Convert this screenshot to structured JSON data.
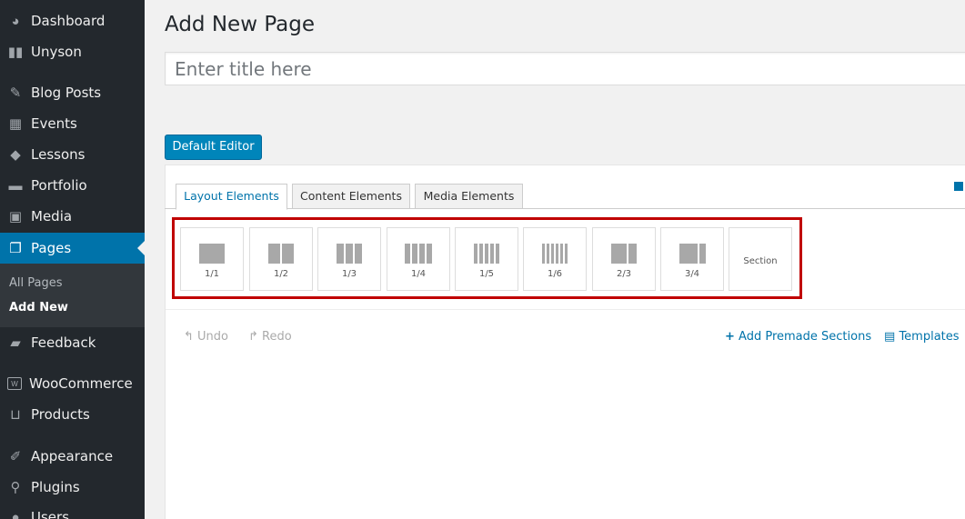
{
  "sidebar": {
    "items": [
      {
        "label": "Dashboard",
        "icon": "dashboard-icon"
      },
      {
        "label": "Unyson",
        "icon": "unyson-icon"
      },
      {
        "label": "Blog Posts",
        "icon": "pin-icon"
      },
      {
        "label": "Events",
        "icon": "calendar-icon"
      },
      {
        "label": "Lessons",
        "icon": "graduation-cap-icon"
      },
      {
        "label": "Portfolio",
        "icon": "folder-icon"
      },
      {
        "label": "Media",
        "icon": "media-icon"
      },
      {
        "label": "Pages",
        "icon": "pages-icon"
      },
      {
        "label": "Feedback",
        "icon": "comment-icon"
      },
      {
        "label": "WooCommerce",
        "icon": "woocommerce-icon"
      },
      {
        "label": "Products",
        "icon": "cart-icon"
      },
      {
        "label": "Appearance",
        "icon": "brush-icon"
      },
      {
        "label": "Plugins",
        "icon": "plugin-icon"
      },
      {
        "label": "Users",
        "icon": "user-icon"
      }
    ],
    "submenu": [
      {
        "label": "All Pages"
      },
      {
        "label": "Add New"
      }
    ]
  },
  "main": {
    "title": "Add New Page",
    "title_placeholder": "Enter title here",
    "editor_button": "Default Editor",
    "tabs": [
      {
        "label": "Layout Elements"
      },
      {
        "label": "Content Elements"
      },
      {
        "label": "Media Elements"
      }
    ],
    "layout_elements": [
      {
        "label": "1/1"
      },
      {
        "label": "1/2"
      },
      {
        "label": "1/3"
      },
      {
        "label": "1/4"
      },
      {
        "label": "1/5"
      },
      {
        "label": "1/6"
      },
      {
        "label": "2/3"
      },
      {
        "label": "3/4"
      },
      {
        "label": "Section"
      }
    ],
    "undo": "Undo",
    "redo": "Redo",
    "add_premade": "Add Premade Sections",
    "templates": "Templates"
  },
  "colors": {
    "sidebar_bg": "#23282d",
    "accent": "#0073aa",
    "highlight_box": "#c00000"
  }
}
